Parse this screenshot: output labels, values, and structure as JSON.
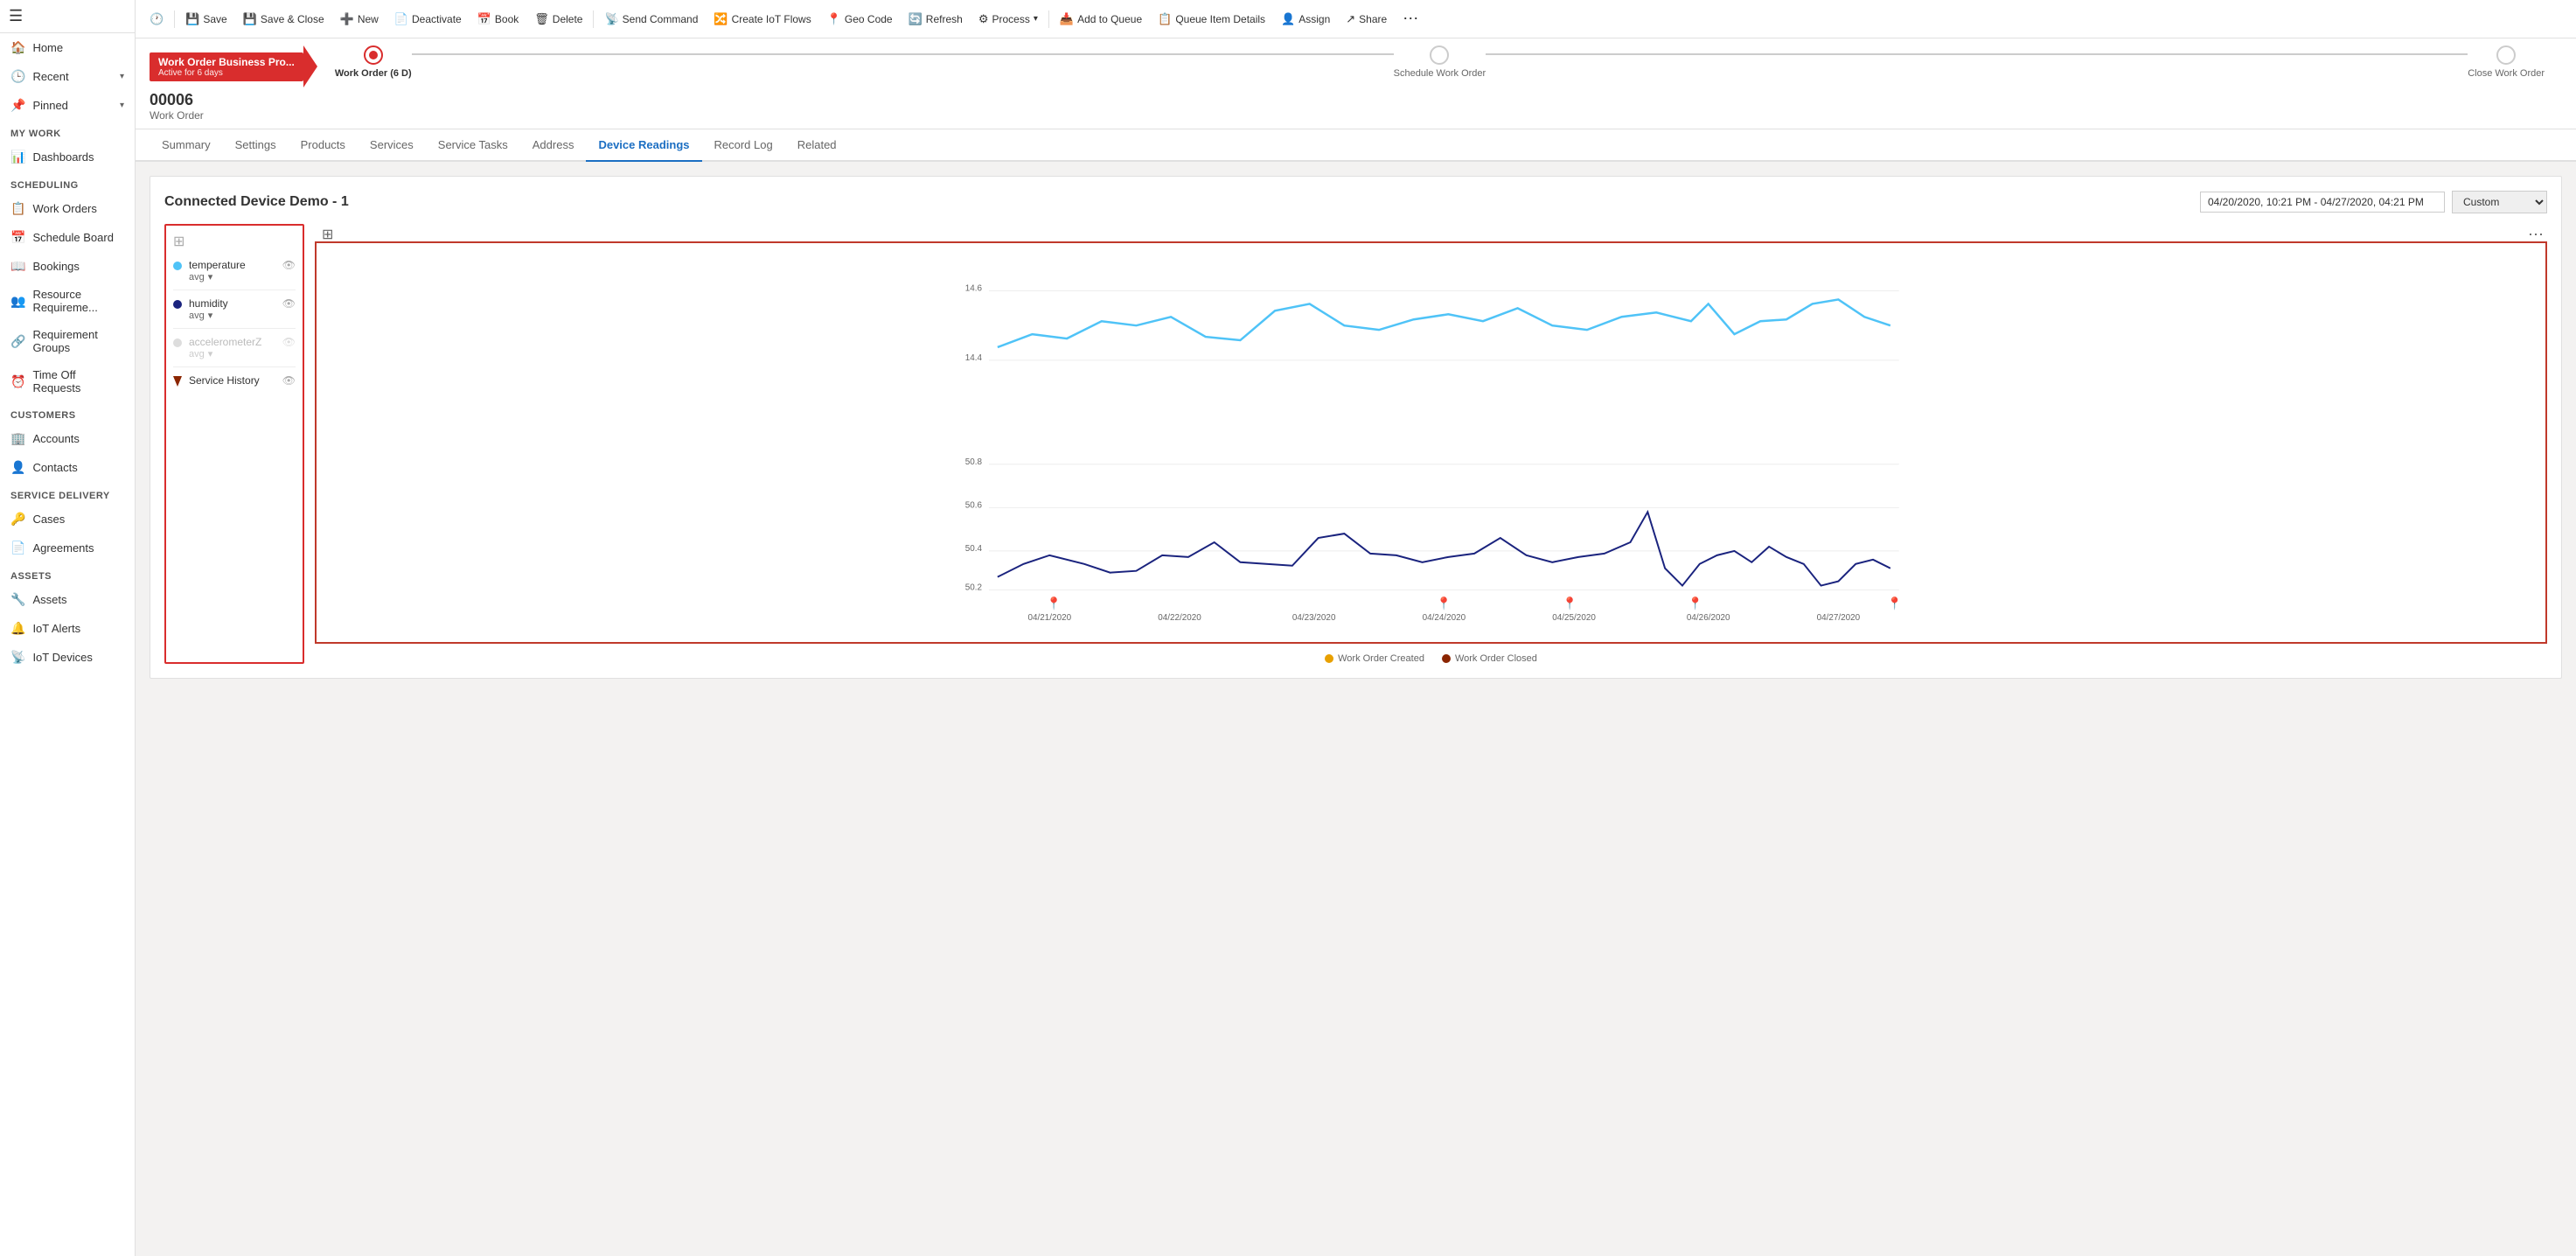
{
  "sidebar": {
    "hamburger": "☰",
    "nav_top": [
      {
        "id": "home",
        "icon": "🏠",
        "label": "Home",
        "chevron": false
      },
      {
        "id": "recent",
        "icon": "🕒",
        "label": "Recent",
        "chevron": true
      },
      {
        "id": "pinned",
        "icon": "📌",
        "label": "Pinned",
        "chevron": true
      }
    ],
    "sections": [
      {
        "header": "My Work",
        "items": [
          {
            "id": "dashboards",
            "icon": "📊",
            "label": "Dashboards"
          }
        ]
      },
      {
        "header": "Scheduling",
        "items": [
          {
            "id": "work-orders",
            "icon": "📋",
            "label": "Work Orders"
          },
          {
            "id": "schedule-board",
            "icon": "📅",
            "label": "Schedule Board"
          },
          {
            "id": "bookings",
            "icon": "📖",
            "label": "Bookings"
          },
          {
            "id": "resource-requirements",
            "icon": "👥",
            "label": "Resource Requireme..."
          },
          {
            "id": "requirement-groups",
            "icon": "🔗",
            "label": "Requirement Groups"
          },
          {
            "id": "time-off-requests",
            "icon": "⏰",
            "label": "Time Off Requests"
          }
        ]
      },
      {
        "header": "Customers",
        "items": [
          {
            "id": "accounts",
            "icon": "🏢",
            "label": "Accounts"
          },
          {
            "id": "contacts",
            "icon": "👤",
            "label": "Contacts"
          }
        ]
      },
      {
        "header": "Service Delivery",
        "items": [
          {
            "id": "cases",
            "icon": "🔑",
            "label": "Cases"
          },
          {
            "id": "agreements",
            "icon": "📄",
            "label": "Agreements"
          }
        ]
      },
      {
        "header": "Assets",
        "items": [
          {
            "id": "assets",
            "icon": "🔧",
            "label": "Assets"
          },
          {
            "id": "iot-alerts",
            "icon": "🔔",
            "label": "IoT Alerts"
          },
          {
            "id": "iot-devices",
            "icon": "📡",
            "label": "IoT Devices"
          }
        ]
      }
    ]
  },
  "toolbar": {
    "buttons": [
      {
        "id": "history",
        "icon": "🕐",
        "label": "",
        "icon_only": true
      },
      {
        "id": "save",
        "icon": "💾",
        "label": "Save"
      },
      {
        "id": "save-close",
        "icon": "💾",
        "label": "Save & Close"
      },
      {
        "id": "new",
        "icon": "➕",
        "label": "New"
      },
      {
        "id": "deactivate",
        "icon": "📄",
        "label": "Deactivate"
      },
      {
        "id": "book",
        "icon": "📅",
        "label": "Book"
      },
      {
        "id": "delete",
        "icon": "🗑",
        "label": "Delete"
      },
      {
        "id": "send-command",
        "icon": "📡",
        "label": "Send Command"
      },
      {
        "id": "create-iot-flows",
        "icon": "🔀",
        "label": "Create IoT Flows"
      },
      {
        "id": "geo-code",
        "icon": "📍",
        "label": "Geo Code"
      },
      {
        "id": "refresh",
        "icon": "🔄",
        "label": "Refresh"
      },
      {
        "id": "process",
        "icon": "⚙",
        "label": "Process",
        "has_chevron": true
      },
      {
        "id": "add-to-queue",
        "icon": "📥",
        "label": "Add to Queue"
      },
      {
        "id": "queue-item-details",
        "icon": "📋",
        "label": "Queue Item Details"
      },
      {
        "id": "assign",
        "icon": "👤",
        "label": "Assign"
      },
      {
        "id": "share",
        "icon": "↗",
        "label": "Share"
      },
      {
        "id": "more",
        "icon": "⋯",
        "label": ""
      }
    ]
  },
  "record": {
    "id": "00006",
    "type": "Work Order"
  },
  "process_flow": {
    "steps": [
      {
        "id": "work-order",
        "label": "Work Order (6 D)",
        "active": true
      },
      {
        "id": "schedule-work-order",
        "label": "Schedule Work Order",
        "active": false
      },
      {
        "id": "close-work-order",
        "label": "Close Work Order",
        "active": false
      }
    ],
    "active_stage": {
      "title": "Work Order Business Pro...",
      "subtitle": "Active for 6 days"
    }
  },
  "tabs": [
    {
      "id": "summary",
      "label": "Summary",
      "active": false
    },
    {
      "id": "settings",
      "label": "Settings",
      "active": false
    },
    {
      "id": "products",
      "label": "Products",
      "active": false
    },
    {
      "id": "services",
      "label": "Services",
      "active": false
    },
    {
      "id": "service-tasks",
      "label": "Service Tasks",
      "active": false
    },
    {
      "id": "address",
      "label": "Address",
      "active": false
    },
    {
      "id": "device-readings",
      "label": "Device Readings",
      "active": true
    },
    {
      "id": "record-log",
      "label": "Record Log",
      "active": false
    },
    {
      "id": "related",
      "label": "Related",
      "active": false
    }
  ],
  "chart": {
    "title": "Connected Device Demo - 1",
    "date_range": "04/20/2020, 10:21 PM - 04/27/2020, 04:21 PM",
    "preset": "Custom",
    "legend": [
      {
        "id": "temperature",
        "label": "temperature",
        "sub": "avg",
        "color": "#4fc3f7",
        "active": true
      },
      {
        "id": "humidity",
        "label": "humidity",
        "sub": "avg",
        "color": "#1a237e",
        "active": true
      },
      {
        "id": "accelerometerZ",
        "label": "accelerometerZ",
        "sub": "avg",
        "color": "#ddd",
        "active": false
      },
      {
        "id": "service-history",
        "label": "Service History",
        "color": "#8B2500",
        "active": true,
        "is_pin": true
      }
    ],
    "x_labels": [
      "04/21/2020",
      "04/22/2020",
      "04/23/2020",
      "04/24/2020",
      "04/25/2020",
      "04/26/2020",
      "04/27/2020"
    ],
    "y_labels_top": [
      "14.6",
      "14.4"
    ],
    "y_labels_bottom": [
      "50.8",
      "50.6",
      "50.4",
      "50.2"
    ],
    "bottom_legend": [
      {
        "label": "Work Order Created",
        "color": "#e8a000"
      },
      {
        "label": "Work Order Closed",
        "color": "#8B2500"
      }
    ]
  }
}
